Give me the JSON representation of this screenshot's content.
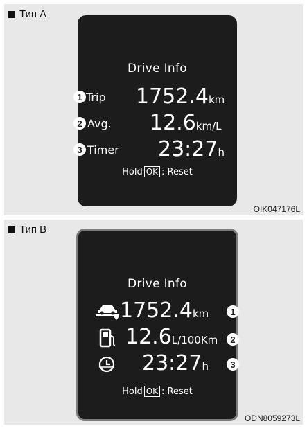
{
  "type_a": {
    "label": "Тип A",
    "code": "OIK047176L",
    "title": "Drive Info",
    "rows": [
      {
        "badge": "1",
        "label": "Trip",
        "value": "1752.4",
        "unit": "km"
      },
      {
        "badge": "2",
        "label": "Avg.",
        "value": "12.6",
        "unit": "km/L"
      },
      {
        "badge": "3",
        "label": "Timer",
        "value": "23:27",
        "unit": "h"
      }
    ],
    "hold": {
      "prefix": "Hold",
      "key": "OK",
      "suffix": ": Reset"
    }
  },
  "type_b": {
    "label": "Тип B",
    "code": "ODN8059273L",
    "title": "Drive Info",
    "rows": [
      {
        "icon": "car-distance-icon",
        "value": "1752.4",
        "unit": "km",
        "badge": "1"
      },
      {
        "icon": "fuel-pump-icon",
        "value": "12.6",
        "unit": "L/100Km",
        "badge": "2"
      },
      {
        "icon": "clock-icon",
        "value": "23:27",
        "unit": "h",
        "badge": "3"
      }
    ],
    "hold": {
      "prefix": "Hold",
      "key": "OK",
      "suffix": ": Reset"
    }
  },
  "colors": {
    "screen_bg": "#1c1c1c",
    "panel_bg": "#e8e8e8",
    "text": "#ffffff",
    "bezel": "#7c7c7c"
  }
}
